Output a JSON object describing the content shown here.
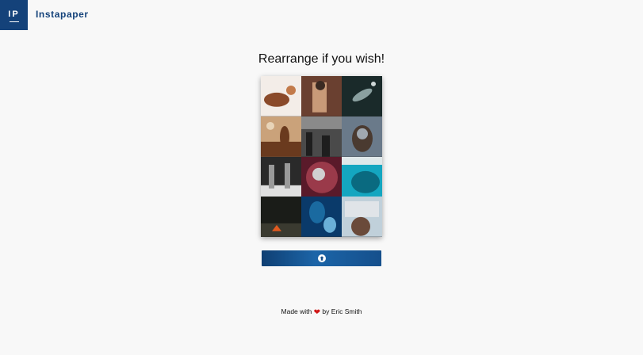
{
  "header": {
    "logo_text": "IP",
    "brand_name": "Instapaper"
  },
  "main": {
    "title": "Rearrange if you wish!",
    "tiles": [
      {
        "name": "tile-frog-on-branch",
        "colors": [
          "#f3ede8",
          "#8a4a2a",
          "#c27a4a"
        ]
      },
      {
        "name": "tile-person-in-room",
        "colors": [
          "#6a4030",
          "#c89a78",
          "#3a2a22"
        ]
      },
      {
        "name": "tile-fish-dark-water",
        "colors": [
          "#1a2a2a",
          "#8aa0a0",
          "#d0d8d8"
        ]
      },
      {
        "name": "tile-person-with-axe",
        "colors": [
          "#caa27a",
          "#6a3a1e",
          "#e8d4b8"
        ]
      },
      {
        "name": "tile-street-crowd",
        "colors": [
          "#4a4a4a",
          "#8a8a8a",
          "#1e1e1e"
        ]
      },
      {
        "name": "tile-face-portrait",
        "colors": [
          "#6a7a8a",
          "#4a3a30",
          "#a0a8b0"
        ]
      },
      {
        "name": "tile-bw-people",
        "colors": [
          "#2a2a2a",
          "#9a9a9a",
          "#e0e0e0"
        ]
      },
      {
        "name": "tile-crowd-aerial",
        "colors": [
          "#5a1a2a",
          "#9a3a4a",
          "#d0d0d0"
        ]
      },
      {
        "name": "tile-turquoise-sea",
        "colors": [
          "#14a6c0",
          "#0a6a80",
          "#dfe8ea"
        ]
      },
      {
        "name": "tile-night-fire",
        "colors": [
          "#1a1c18",
          "#3a3a30",
          "#e05a20"
        ]
      },
      {
        "name": "tile-underwater-divers",
        "colors": [
          "#0a3a6a",
          "#1a6aa0",
          "#6ab0d8"
        ]
      },
      {
        "name": "tile-child-by-window",
        "colors": [
          "#c0d0da",
          "#6a4a3a",
          "#e0e4e8"
        ]
      }
    ]
  },
  "upload": {
    "icon": "arrow-up-circle-icon"
  },
  "footer": {
    "made_with": "Made with",
    "heart": "❤",
    "by": "by Eric Smith"
  }
}
